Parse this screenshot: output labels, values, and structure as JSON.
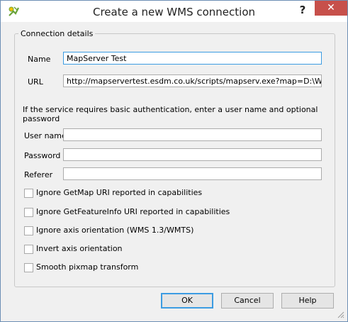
{
  "window": {
    "title": "Create a new WMS connection",
    "help_label": "?",
    "close_label": "✕"
  },
  "group": {
    "title": "Connection details"
  },
  "fields": {
    "name_label": "Name",
    "name_value": "MapServer Test",
    "url_label": "URL",
    "url_value": "http://mapservertest.esdm.co.uk/scripts/mapserv.exe?map=D:\\Websites\\",
    "auth_hint": "If the service requires basic authentication, enter a user name and optional password",
    "username_label": "User name",
    "username_value": "",
    "password_label": "Password",
    "password_value": "",
    "referer_label": "Referer",
    "referer_value": ""
  },
  "options": [
    {
      "label": "Ignore GetMap URI reported in capabilities",
      "checked": false
    },
    {
      "label": "Ignore GetFeatureInfo URI reported in capabilities",
      "checked": false
    },
    {
      "label": "Ignore axis orientation (WMS 1.3/WMTS)",
      "checked": false
    },
    {
      "label": "Invert axis orientation",
      "checked": false
    },
    {
      "label": "Smooth pixmap transform",
      "checked": false
    }
  ],
  "buttons": {
    "ok": "OK",
    "cancel": "Cancel",
    "help": "Help"
  },
  "colors": {
    "focus_border": "#3c9ce2",
    "close_button": "#c7504b"
  }
}
